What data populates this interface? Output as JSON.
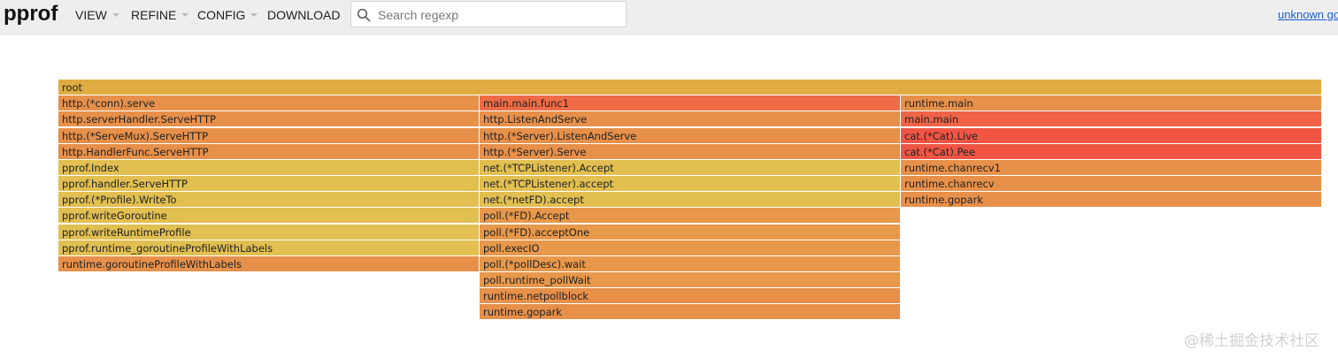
{
  "header": {
    "logo": "pprof",
    "menus": [
      {
        "label": "VIEW",
        "has_dropdown": true
      },
      {
        "label": "REFINE",
        "has_dropdown": true
      },
      {
        "label": "CONFIG",
        "has_dropdown": true
      },
      {
        "label": "DOWNLOAD",
        "has_dropdown": false
      }
    ],
    "search_placeholder": "Search regexp",
    "search_value": "",
    "right_link": "unknown go"
  },
  "flamegraph": {
    "frames": [
      {
        "label": "root",
        "color": "#dfad42"
      },
      {
        "label": "http.(*conn).serve",
        "color": "#e7904a"
      },
      {
        "label": "http.serverHandler.ServeHTTP",
        "color": "#e7904a"
      },
      {
        "label": "http.(*ServeMux).ServeHTTP",
        "color": "#e7904a"
      },
      {
        "label": "http.HandlerFunc.ServeHTTP",
        "color": "#e7904a"
      },
      {
        "label": "pprof.Index",
        "color": "#e1bf50"
      },
      {
        "label": "pprof.handler.ServeHTTP",
        "color": "#e1bf50"
      },
      {
        "label": "pprof.(*Profile).WriteTo",
        "color": "#e1bf50"
      },
      {
        "label": "pprof.writeGoroutine",
        "color": "#e1bf50"
      },
      {
        "label": "pprof.writeRuntimeProfile",
        "color": "#e1bf50"
      },
      {
        "label": "pprof.runtime_goroutineProfileWithLabels",
        "color": "#e1bf50"
      },
      {
        "label": "runtime.goroutineProfileWithLabels",
        "color": "#e7904a"
      },
      {
        "label": "main.main.func1",
        "color": "#ef6b46"
      },
      {
        "label": "http.ListenAndServe",
        "color": "#e7904a"
      },
      {
        "label": "http.(*Server).ListenAndServe",
        "color": "#e7904a"
      },
      {
        "label": "http.(*Server).Serve",
        "color": "#e7904a"
      },
      {
        "label": "net.(*TCPListener).Accept",
        "color": "#e1bf50"
      },
      {
        "label": "net.(*TCPListener).accept",
        "color": "#e1bf50"
      },
      {
        "label": "net.(*netFD).accept",
        "color": "#e1bf50"
      },
      {
        "label": "poll.(*FD).Accept",
        "color": "#e7984a"
      },
      {
        "label": "poll.(*FD).acceptOne",
        "color": "#e7984a"
      },
      {
        "label": "poll.execIO",
        "color": "#e7984a"
      },
      {
        "label": "poll.(*pollDesc).wait",
        "color": "#e7984a"
      },
      {
        "label": "poll.runtime_pollWait",
        "color": "#e7984a"
      },
      {
        "label": "runtime.netpollblock",
        "color": "#e7904a"
      },
      {
        "label": "runtime.gopark",
        "color": "#e7904a"
      },
      {
        "label": "runtime.main",
        "color": "#e7904a"
      },
      {
        "label": "main.main",
        "color": "#ef6347"
      },
      {
        "label": "cat.(*Cat).Live",
        "color": "#f05544"
      },
      {
        "label": "cat.(*Cat).Pee",
        "color": "#f05544"
      },
      {
        "label": "runtime.chanrecv1",
        "color": "#e7904a"
      },
      {
        "label": "runtime.chanrecv",
        "color": "#e7904a"
      },
      {
        "label": "runtime.gopark",
        "color": "#e7904a"
      }
    ]
  },
  "watermark": "@稀土掘金技术社区"
}
